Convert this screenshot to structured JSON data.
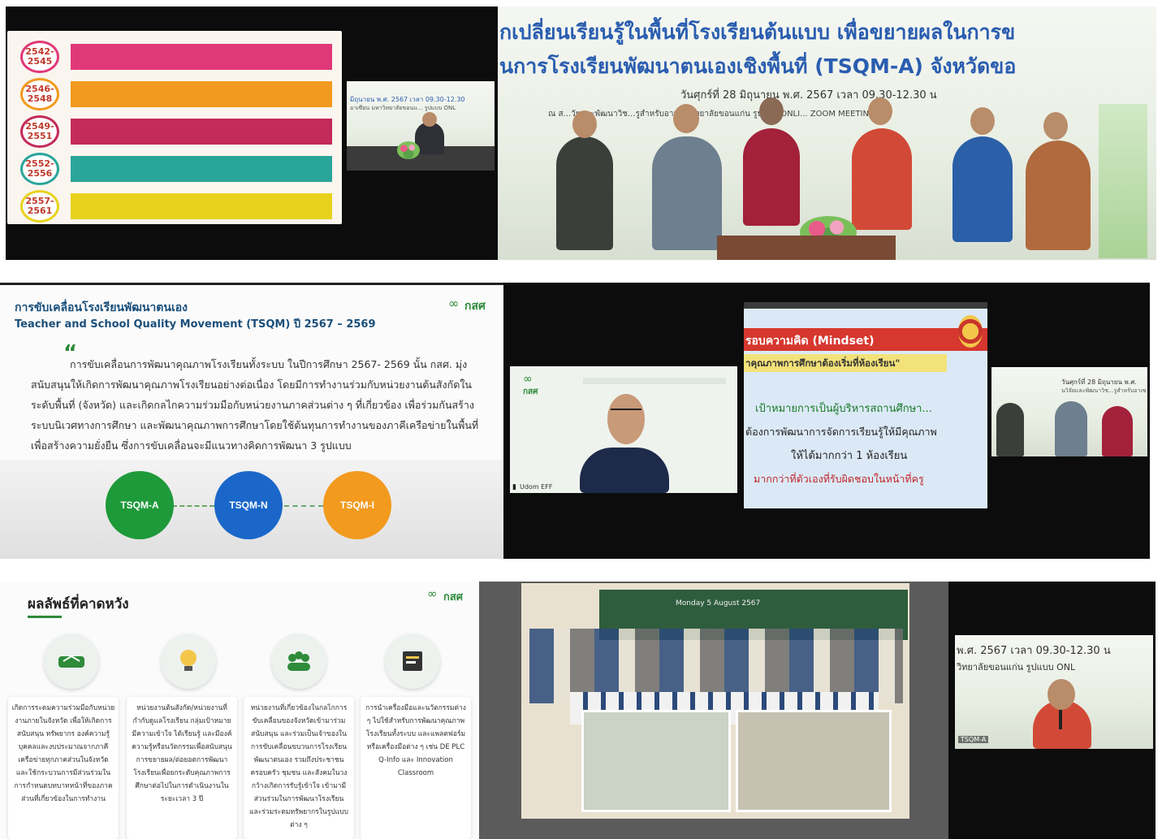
{
  "panel1": {
    "timeline": [
      {
        "year": "2542-\n2545",
        "color": "#e0397a"
      },
      {
        "year": "2546-\n2548",
        "color": "#f29a1e"
      },
      {
        "year": "2549-\n2551",
        "color": "#c42a5a"
      },
      {
        "year": "2552-\n2556",
        "color": "#2aa59a"
      },
      {
        "year": "2557-\n2561",
        "color": "#e8d21c"
      }
    ],
    "inset_banner": "มิถุนายน พ.ศ. 2567 เวลา 09.30-12.30",
    "inset_banner2": "อาเซียน มหาวิทยาลัยขอนแ... รูปแบบ ONL"
  },
  "panel2": {
    "banner_line1": "กเปลี่ยนเรียนรู้ในพื้นที่โรงเรียนต้นแบบ เพื่อขยายผลในการข",
    "banner_line2": "นการโรงเรียนพัฒนาตนเองเชิงพื้นที่ (TSQM-A) จังหวัดขอ",
    "date_line": "วันศุกร์ที่ 28 มิถุนายน พ.ศ. 2567 เวลา 09.30-12.30 น",
    "venue_line": "ณ ส...วัยและพัฒนาวิช...รูสำหรับอาเซี...วิทยาลัยขอนแก่น รูปแบบ ONLI... ZOOM MEETING"
  },
  "panel3": {
    "title_th": "การขับเคลื่อนโรงเรียนพัฒนาตนเอง",
    "title_en": "Teacher and School Quality Movement (TSQM) ปี 2567 – 2569",
    "logo_text": "กสศ",
    "quote": "การขับเคลื่อนการพัฒนาคุณภาพโรงเรียนทั้งระบบ ในปีการศึกษา 2567- 2569 นั้น กสศ. มุ่งสนับสนุนให้เกิดการพัฒนาคุณภาพโรงเรียนอย่างต่อเนื่อง โดยมีการทำงานร่วมกับหน่วยงานต้นสังกัดในระดับพื้นที่ (จังหวัด) และเกิดกลไกความร่วมมือกับหน่วยงานภาคส่วนต่าง ๆ ที่เกี่ยวข้อง เพื่อร่วมกันสร้างระบบนิเวศทางการศึกษา และพัฒนาคุณภาพการศึกษาโดยใช้ต้นทุนการทำงานของภาคีเครือข่ายในพื้นที่เพื่อสร้างความยั่งยืน ซึ่งการขับเคลื่อนจะมีแนวทางคิดการพัฒนา 3 รูปแบบ",
    "nodes": [
      {
        "label": "TSQM-A",
        "color": "#1e9a3a"
      },
      {
        "label": "TSQM-N",
        "color": "#1a67c9"
      },
      {
        "label": "TSQM-I",
        "color": "#f29a1e"
      }
    ]
  },
  "panel4": {
    "logo_text": "กสศ",
    "participant_name": "Udom EFF"
  },
  "panel5": {
    "header": "รอบความคิด (Mindset)",
    "subheader": "าคุณภาพการศึกษาต้องเริ่มที่ห้องเรียน\"",
    "line1": "เป้าหมายการเป็นผู้บริหารสถานศึกษา...",
    "line2": "ต้องการพัฒนาการจัดการเรียนรู้ให้มีคุณภาพ",
    "line3": "ให้ได้มากกว่า 1 ห้องเรียน",
    "line4": "มากกว่าที่ตัวเองที่รับผิดชอบในหน้าที่ครู"
  },
  "panel6": {
    "date_line": "วันศุกร์ที่ 28 มิถุนายน พ.ศ.",
    "venue_line": "นวิจัยและพัฒนาวิช...รูสำหรับอาเซ"
  },
  "panel7": {
    "title": "ผลลัพธ์ที่คาดหวัง",
    "logo_text": "กสศ",
    "cards": [
      {
        "text": "เกิดการระดมความร่วมมือกับหน่วยงานภายในจังหวัด เพื่อให้เกิดการสนับสนุน ทรัพยากร องค์ความรู้ บุคคลและงบประมาณจากภาคีเครือข่ายทุกภาคส่วนในจังหวัด และใช้กระบวนการมีส่วนร่วมในการกำหนดบทบาทหน้าที่ของภาคส่วนที่เกี่ยวข้องในการทำงาน"
      },
      {
        "text": "หน่วยงานต้นสังกัด/หน่วยงานที่กำกับดูแลโรงเรียน กลุ่มเป้าหมาย มีความเข้าใจ ได้เรียนรู้ และมีองค์ความรู้หรือนวัตกรรมเพื่อสนับสนุนการขยายผล/ต่อยอดการพัฒนาโรงเรียนเพื่อยกระดับคุณภาพการศึกษาต่อไปในการดำเนินงานในระยะเวลา 3 ปี"
      },
      {
        "text": "หน่วยงานที่เกี่ยวข้องในกลไกการขับเคลื่อนของจังหวัดเข้ามาร่วมสนับสนุน และร่วมเป็นเจ้าของในการขับเคลื่อนขบวนการโรงเรียนพัฒนาตนเอง รวมถึงประชาชน ครอบครัว ชุมชน และสังคมในวงกว้างเกิดการรับรู้เข้าใจ เข้ามามีส่วนร่วมในการพัฒนาโรงเรียน และร่วมระดมทรัพยากรในรูปแบบต่าง ๆ"
      },
      {
        "text": "การนำเครื่องมือและนวัตกรรมต่าง ๆ ไปใช้สำหรับการพัฒนาคุณภาพโรงเรียนทั้งระบบ และแพลตฟอร์มหรือเครื่องมือต่าง ๆ เช่น DE PLC Q-Info และ Innovation Classroom"
      }
    ]
  },
  "panel8": {
    "board_text": "Monday 5 August 2567"
  },
  "panel9": {
    "date_line": "พ.ศ. 2567 เวลา 09.30-12.30 น",
    "venue_line": "วิทยาลัยขอนแก่น รูปแบบ ONL",
    "tag": "TSQM-A"
  },
  "colors": {
    "blue_text": "#2a5db0",
    "green_brand": "#2e8b3a",
    "red_header": "#d6372e"
  }
}
